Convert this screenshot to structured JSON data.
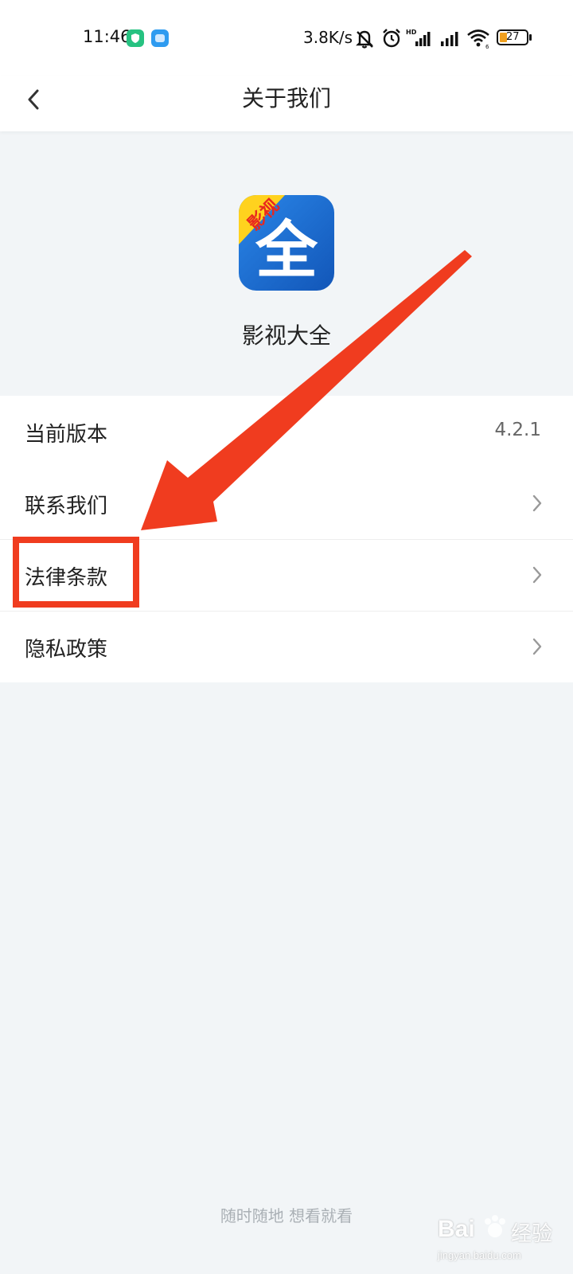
{
  "status_bar": {
    "time": "11:46",
    "network_speed": "3.8K/s",
    "battery_level": "27",
    "icons": [
      "shield-app-icon",
      "cloud-app-icon",
      "muted-bell-icon",
      "alarm-icon",
      "hd-signal-icon",
      "signal-icon",
      "wifi-icon",
      "battery-icon"
    ]
  },
  "header": {
    "title": "关于我们"
  },
  "app": {
    "logo_badge": "影视",
    "logo_char": "全",
    "name": "影视大全"
  },
  "menu": {
    "items": [
      {
        "label": "当前版本",
        "value": "4.2.1"
      },
      {
        "label": "联系我们"
      },
      {
        "label": "法律条款"
      },
      {
        "label": "隐私政策"
      }
    ]
  },
  "footer": {
    "slogan": "随时随地 想看就看"
  },
  "watermark": {
    "brand": "Bai",
    "brand_cn": "经验",
    "url": "jingyan.baidu.com"
  },
  "colors": {
    "annotation_red": "#f03c1f",
    "logo_blue": "#1e6fd2",
    "logo_yellow": "#ffd21e",
    "background": "#f2f5f7"
  }
}
